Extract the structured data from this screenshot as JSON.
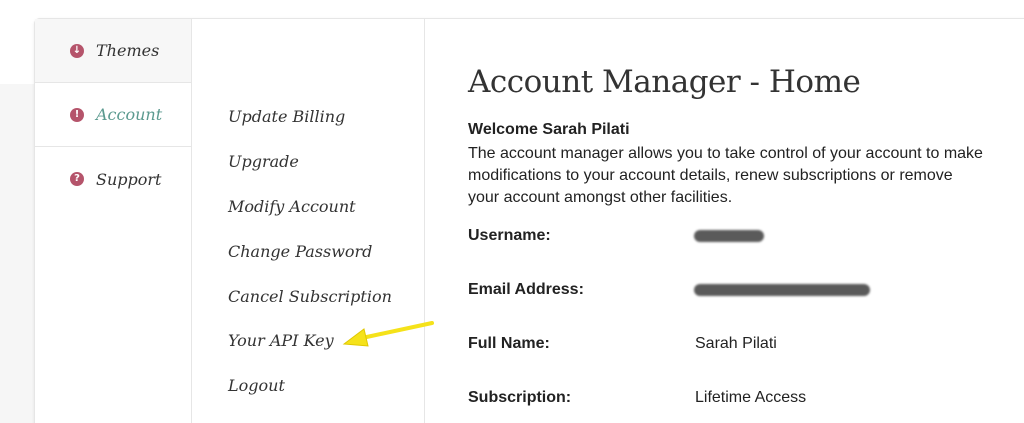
{
  "tabs": [
    {
      "label": "Themes",
      "icon": "down-arrow-circle-icon",
      "active": false
    },
    {
      "label": "Account",
      "icon": "info-circle-icon",
      "active": true
    },
    {
      "label": "Support",
      "icon": "question-circle-icon",
      "active": false
    }
  ],
  "subnav": {
    "items": [
      "Update Billing",
      "Upgrade",
      "Modify Account",
      "Change Password",
      "Cancel Subscription",
      "Your API Key",
      "Logout"
    ]
  },
  "main": {
    "title": "Account Manager - Home",
    "welcome": "Welcome Sarah Pilati",
    "intro": "The account manager allows you to take control of your account to make modifications to your account details, renew subscriptions or remove your account amongst other facilities.",
    "fields": [
      {
        "label": "Username:",
        "value": "",
        "redacted": true
      },
      {
        "label": "Email Address:",
        "value": "",
        "redacted": true
      },
      {
        "label": "Full Name:",
        "value": "Sarah Pilati",
        "redacted": false
      },
      {
        "label": "Subscription:",
        "value": "Lifetime Access",
        "redacted": false
      }
    ]
  },
  "colors": {
    "accent": "#5b9a8f",
    "icon": "#b5546b",
    "highlight_arrow": "#f5e21a"
  }
}
